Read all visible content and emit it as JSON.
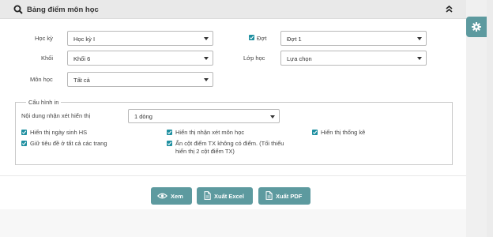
{
  "header": {
    "title": "Bảng điểm môn học"
  },
  "filters": {
    "hoc_ky": {
      "label": "Học kỳ",
      "value": "Học kỳ I"
    },
    "khoi": {
      "label": "Khối",
      "value": "Khối 6"
    },
    "mon_hoc": {
      "label": "Môn học",
      "value": "Tất cả"
    },
    "dot": {
      "label": "Đợt",
      "value": "Đợt 1",
      "checked": true
    },
    "lop_hoc": {
      "label": "Lớp học",
      "value": "Lựa chọn"
    }
  },
  "print_config": {
    "legend": "Cấu hình in",
    "comment_label": "Nội dung nhận xét hiển thị",
    "comment_value": "1 dòng",
    "options": {
      "show_birthday": "Hiển thị ngày sinh HS",
      "keep_header": "Giữ tiêu đề ở tất cả các trang",
      "show_subject_comment": "Hiển thị nhận xét môn học",
      "hide_empty_tx_line1": "Ẩn cột điểm TX không có điểm. (Tối thiểu",
      "hide_empty_tx_line2": "hiển thị 2 cột điểm TX)",
      "show_stats": "Hiển thị thống kê"
    }
  },
  "actions": {
    "view": "Xem",
    "export_excel": "Xuất Excel",
    "export_pdf": "Xuất PDF"
  },
  "colors": {
    "accent": "#5d9a9f",
    "checkbox": "#1e8fa0"
  },
  "icons": [
    "search-icon",
    "collapse-icon",
    "checkbox-icon",
    "eye-icon",
    "file-icon",
    "gear-icon"
  ]
}
